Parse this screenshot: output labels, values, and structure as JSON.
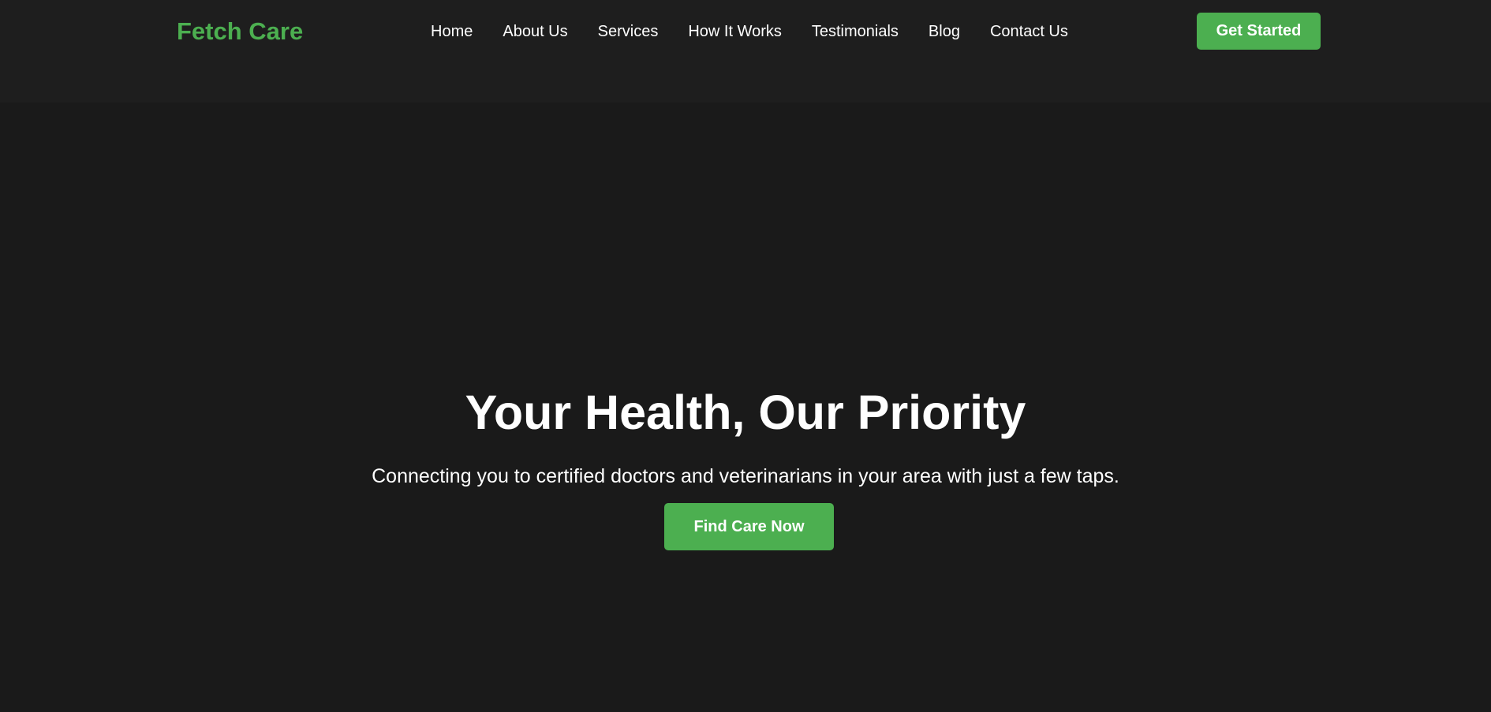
{
  "brand": {
    "name": "Fetch Care",
    "accent_color": "#4caf50"
  },
  "nav": {
    "items": [
      {
        "label": "Home"
      },
      {
        "label": "About Us"
      },
      {
        "label": "Services"
      },
      {
        "label": "How It Works"
      },
      {
        "label": "Testimonials"
      },
      {
        "label": "Blog"
      },
      {
        "label": "Contact Us"
      }
    ]
  },
  "header": {
    "cta_label": "Get Started",
    "background_color": "#1e1e1e"
  },
  "hero": {
    "title": "Your Health, Our Priority",
    "subtitle": "Connecting you to certified doctors and veterinarians in your area with just a few taps.",
    "cta_label": "Find Care Now",
    "background_color": "#1a1a1a"
  }
}
